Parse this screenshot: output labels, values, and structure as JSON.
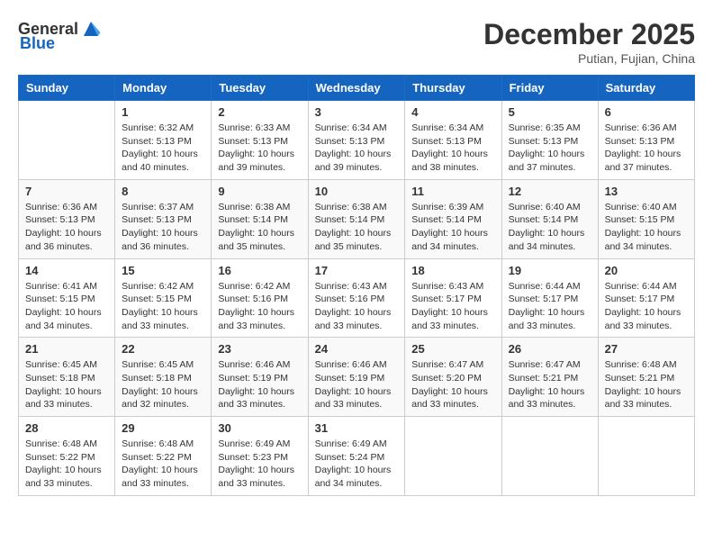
{
  "header": {
    "logo_general": "General",
    "logo_blue": "Blue",
    "month_year": "December 2025",
    "location": "Putian, Fujian, China"
  },
  "columns": [
    "Sunday",
    "Monday",
    "Tuesday",
    "Wednesday",
    "Thursday",
    "Friday",
    "Saturday"
  ],
  "weeks": [
    [
      {
        "day": "",
        "info": ""
      },
      {
        "day": "1",
        "info": "Sunrise: 6:32 AM\nSunset: 5:13 PM\nDaylight: 10 hours and 40 minutes."
      },
      {
        "day": "2",
        "info": "Sunrise: 6:33 AM\nSunset: 5:13 PM\nDaylight: 10 hours and 39 minutes."
      },
      {
        "day": "3",
        "info": "Sunrise: 6:34 AM\nSunset: 5:13 PM\nDaylight: 10 hours and 39 minutes."
      },
      {
        "day": "4",
        "info": "Sunrise: 6:34 AM\nSunset: 5:13 PM\nDaylight: 10 hours and 38 minutes."
      },
      {
        "day": "5",
        "info": "Sunrise: 6:35 AM\nSunset: 5:13 PM\nDaylight: 10 hours and 37 minutes."
      },
      {
        "day": "6",
        "info": "Sunrise: 6:36 AM\nSunset: 5:13 PM\nDaylight: 10 hours and 37 minutes."
      }
    ],
    [
      {
        "day": "7",
        "info": "Sunrise: 6:36 AM\nSunset: 5:13 PM\nDaylight: 10 hours and 36 minutes."
      },
      {
        "day": "8",
        "info": "Sunrise: 6:37 AM\nSunset: 5:13 PM\nDaylight: 10 hours and 36 minutes."
      },
      {
        "day": "9",
        "info": "Sunrise: 6:38 AM\nSunset: 5:14 PM\nDaylight: 10 hours and 35 minutes."
      },
      {
        "day": "10",
        "info": "Sunrise: 6:38 AM\nSunset: 5:14 PM\nDaylight: 10 hours and 35 minutes."
      },
      {
        "day": "11",
        "info": "Sunrise: 6:39 AM\nSunset: 5:14 PM\nDaylight: 10 hours and 34 minutes."
      },
      {
        "day": "12",
        "info": "Sunrise: 6:40 AM\nSunset: 5:14 PM\nDaylight: 10 hours and 34 minutes."
      },
      {
        "day": "13",
        "info": "Sunrise: 6:40 AM\nSunset: 5:15 PM\nDaylight: 10 hours and 34 minutes."
      }
    ],
    [
      {
        "day": "14",
        "info": "Sunrise: 6:41 AM\nSunset: 5:15 PM\nDaylight: 10 hours and 34 minutes."
      },
      {
        "day": "15",
        "info": "Sunrise: 6:42 AM\nSunset: 5:15 PM\nDaylight: 10 hours and 33 minutes."
      },
      {
        "day": "16",
        "info": "Sunrise: 6:42 AM\nSunset: 5:16 PM\nDaylight: 10 hours and 33 minutes."
      },
      {
        "day": "17",
        "info": "Sunrise: 6:43 AM\nSunset: 5:16 PM\nDaylight: 10 hours and 33 minutes."
      },
      {
        "day": "18",
        "info": "Sunrise: 6:43 AM\nSunset: 5:17 PM\nDaylight: 10 hours and 33 minutes."
      },
      {
        "day": "19",
        "info": "Sunrise: 6:44 AM\nSunset: 5:17 PM\nDaylight: 10 hours and 33 minutes."
      },
      {
        "day": "20",
        "info": "Sunrise: 6:44 AM\nSunset: 5:17 PM\nDaylight: 10 hours and 33 minutes."
      }
    ],
    [
      {
        "day": "21",
        "info": "Sunrise: 6:45 AM\nSunset: 5:18 PM\nDaylight: 10 hours and 33 minutes."
      },
      {
        "day": "22",
        "info": "Sunrise: 6:45 AM\nSunset: 5:18 PM\nDaylight: 10 hours and 32 minutes."
      },
      {
        "day": "23",
        "info": "Sunrise: 6:46 AM\nSunset: 5:19 PM\nDaylight: 10 hours and 33 minutes."
      },
      {
        "day": "24",
        "info": "Sunrise: 6:46 AM\nSunset: 5:19 PM\nDaylight: 10 hours and 33 minutes."
      },
      {
        "day": "25",
        "info": "Sunrise: 6:47 AM\nSunset: 5:20 PM\nDaylight: 10 hours and 33 minutes."
      },
      {
        "day": "26",
        "info": "Sunrise: 6:47 AM\nSunset: 5:21 PM\nDaylight: 10 hours and 33 minutes."
      },
      {
        "day": "27",
        "info": "Sunrise: 6:48 AM\nSunset: 5:21 PM\nDaylight: 10 hours and 33 minutes."
      }
    ],
    [
      {
        "day": "28",
        "info": "Sunrise: 6:48 AM\nSunset: 5:22 PM\nDaylight: 10 hours and 33 minutes."
      },
      {
        "day": "29",
        "info": "Sunrise: 6:48 AM\nSunset: 5:22 PM\nDaylight: 10 hours and 33 minutes."
      },
      {
        "day": "30",
        "info": "Sunrise: 6:49 AM\nSunset: 5:23 PM\nDaylight: 10 hours and 33 minutes."
      },
      {
        "day": "31",
        "info": "Sunrise: 6:49 AM\nSunset: 5:24 PM\nDaylight: 10 hours and 34 minutes."
      },
      {
        "day": "",
        "info": ""
      },
      {
        "day": "",
        "info": ""
      },
      {
        "day": "",
        "info": ""
      }
    ]
  ]
}
